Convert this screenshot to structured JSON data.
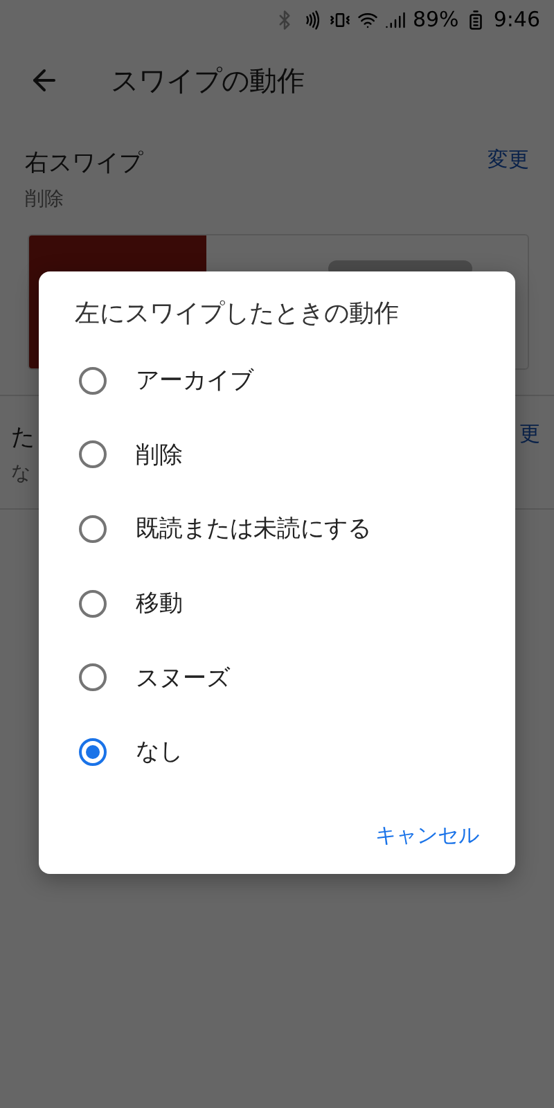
{
  "status_bar": {
    "battery": "89%",
    "time": "9:46"
  },
  "app_bar": {
    "title": "スワイプの動作"
  },
  "sections": [
    {
      "title": "右スワイプ",
      "value": "削除",
      "action": "変更",
      "preview": true
    },
    {
      "title": "た",
      "value": "な",
      "action": "更",
      "preview": false
    }
  ],
  "dialog": {
    "title": "左にスワイプしたときの動作",
    "options": [
      {
        "label": "アーカイブ",
        "selected": false
      },
      {
        "label": "削除",
        "selected": false
      },
      {
        "label": "既読または未読にする",
        "selected": false
      },
      {
        "label": "移動",
        "selected": false
      },
      {
        "label": "スヌーズ",
        "selected": false
      },
      {
        "label": "なし",
        "selected": true
      }
    ],
    "buttons": [
      "キャンセル"
    ]
  }
}
